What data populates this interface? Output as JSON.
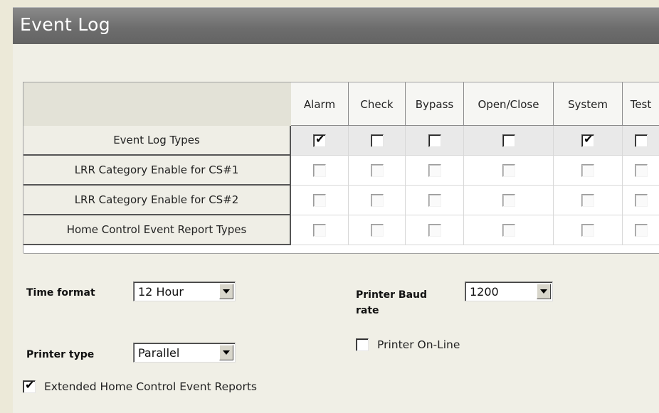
{
  "title": "Event Log",
  "columns": [
    "Alarm",
    "Check",
    "Bypass",
    "Open/Close",
    "System",
    "Test"
  ],
  "rows": [
    {
      "label": "Event Log Types",
      "checked": [
        true,
        false,
        false,
        false,
        true,
        false
      ],
      "enabled": true
    },
    {
      "label": "LRR Category Enable for CS#1",
      "checked": [
        false,
        false,
        false,
        false,
        false,
        false
      ],
      "enabled": false
    },
    {
      "label": "LRR Category Enable for CS#2",
      "checked": [
        false,
        false,
        false,
        false,
        false,
        false
      ],
      "enabled": false
    },
    {
      "label": "Home Control Event Report Types",
      "checked": [
        false,
        false,
        false,
        false,
        false,
        false
      ],
      "enabled": false
    }
  ],
  "time_format": {
    "label": "Time format",
    "value": "12 Hour"
  },
  "printer_type": {
    "label": "Printer type",
    "value": "Parallel"
  },
  "printer_baud": {
    "label_line1": "Printer Baud",
    "label_line2": "rate",
    "value": "1200"
  },
  "printer_online": {
    "label": "Printer On-Line",
    "checked": false
  },
  "extended_reports": {
    "label": "Extended Home Control Event Reports",
    "checked": true
  },
  "checkmark_glyph": "✔",
  "icons": {
    "dropdown": "chevron-down-icon",
    "check": "check-icon"
  }
}
